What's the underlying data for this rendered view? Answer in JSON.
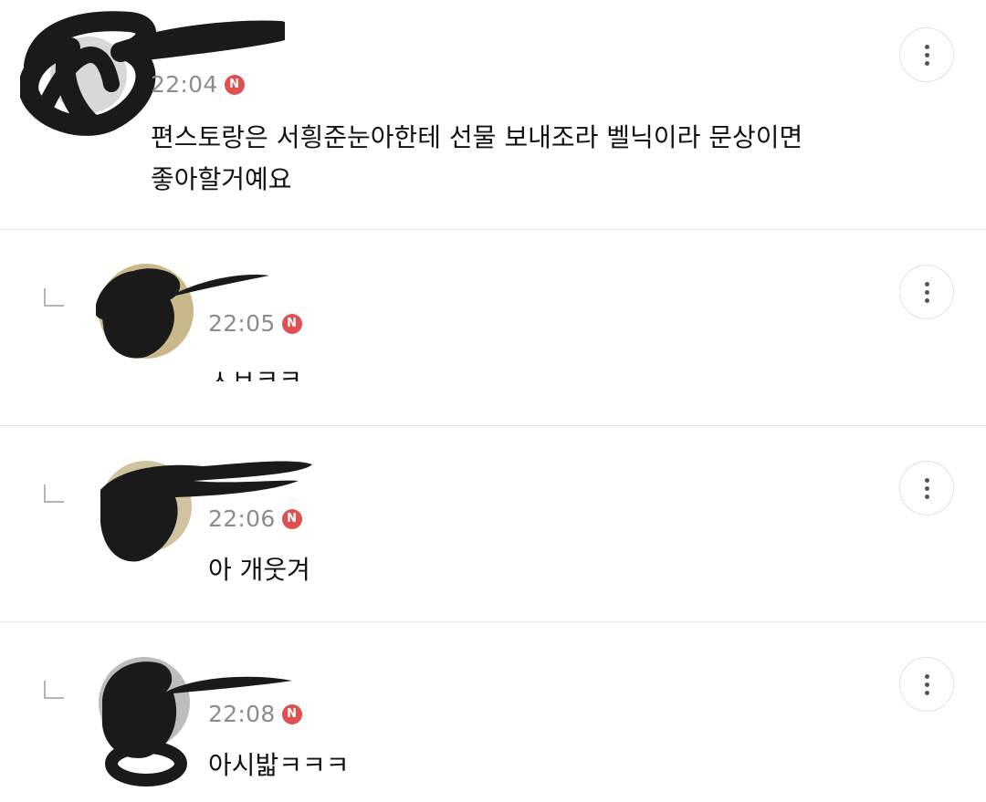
{
  "comments": [
    {
      "time": "22:04",
      "badge": "N",
      "text": "편스토랑은 서힁준눈아한테 선물 보내조라 벨닉이라 문상이면\n좋아할거예요",
      "reply": false,
      "more_label": "more-options"
    },
    {
      "time": "22:05",
      "badge": "N",
      "text": "ㅅㅂㅋㅋ",
      "reply": true,
      "more_label": "more-options"
    },
    {
      "time": "22:06",
      "badge": "N",
      "text": "아 개웃겨",
      "reply": true,
      "more_label": "more-options"
    },
    {
      "time": "22:08",
      "badge": "N",
      "text": "아시밟ㅋㅋㅋ",
      "reply": true,
      "more_label": "more-options"
    }
  ],
  "colors": {
    "badge": "#e05050",
    "time": "#8c8c8c",
    "scribble": "#1a1a1a",
    "divider": "#e4e4e4"
  },
  "icons": {
    "more": "vertical-ellipsis-icon",
    "reply": "reply-arrow-icon",
    "badge": "new-badge-icon"
  }
}
